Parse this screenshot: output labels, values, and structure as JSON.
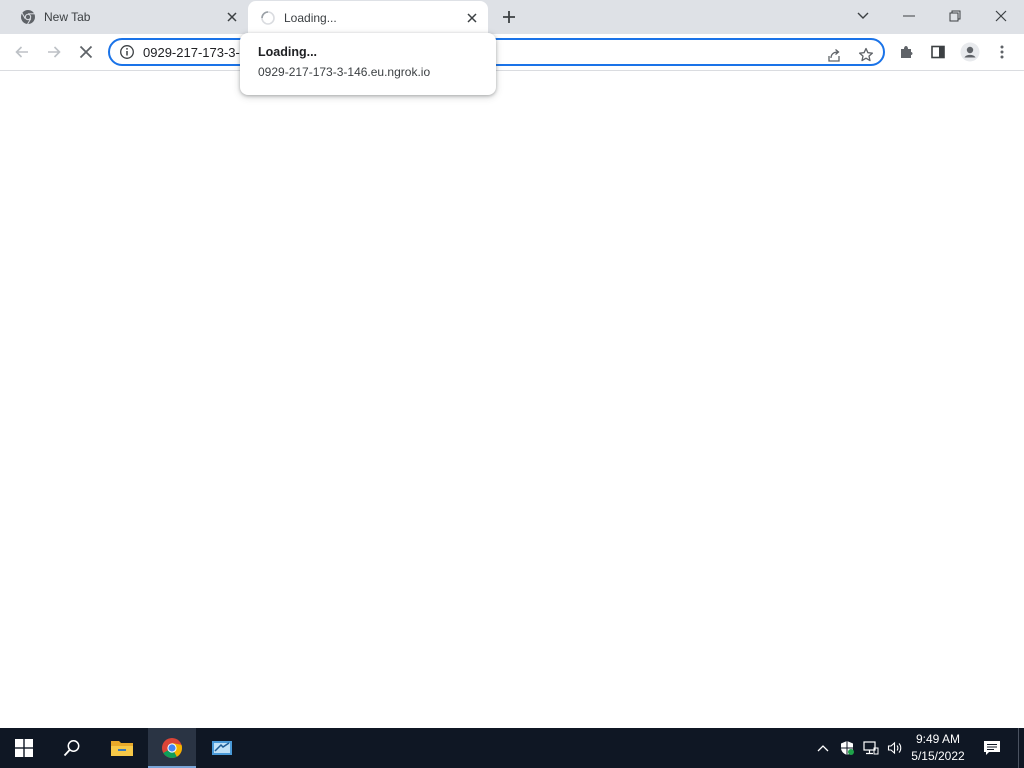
{
  "tabs": [
    {
      "title": "New Tab",
      "favicon": "chrome-icon"
    },
    {
      "title": "Loading...",
      "favicon": "loading-spinner-icon",
      "active": true
    }
  ],
  "toolbar": {
    "url": "0929-217-173-3-146.eu.ngrok.io"
  },
  "hovercard": {
    "title": "Loading...",
    "url": "0929-217-173-3-146.eu.ngrok.io"
  },
  "taskbar": {
    "apps": [
      "start-icon",
      "search-icon",
      "file-explorer-icon",
      "chrome-icon",
      "server-manager-icon"
    ],
    "time": "9:49 AM",
    "date": "5/15/2022"
  },
  "colors": {
    "accent": "#1a73e8",
    "tabstrip_bg": "#dee1e6",
    "taskbar_bg": "#0f1724"
  }
}
